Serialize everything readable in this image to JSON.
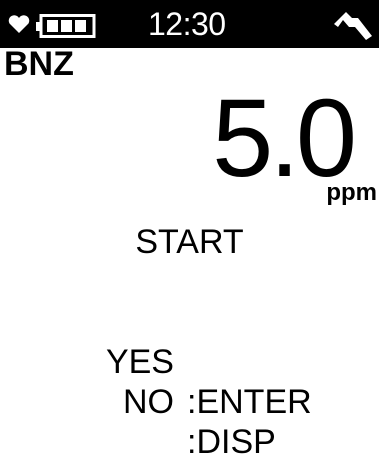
{
  "status_bar": {
    "time": "12:30",
    "icons": [
      "heart-icon",
      "battery-icon",
      "signal-icon"
    ],
    "background": "#000000",
    "foreground": "#ffffff"
  },
  "gas": {
    "name": "BNZ",
    "reading": "5.0",
    "unit": "ppm"
  },
  "prompt": {
    "message": "START",
    "options": [
      {
        "key": "YES",
        "action": ":ENTER"
      },
      {
        "key": "NO",
        "action": ":DISP"
      }
    ]
  }
}
